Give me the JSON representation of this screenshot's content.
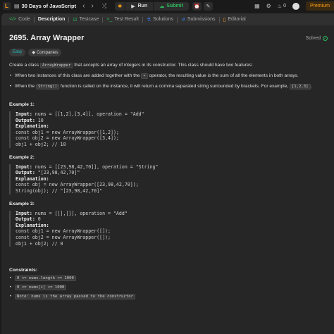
{
  "topbar": {
    "list_title": "30 Days of JavaScript",
    "run_label": "Run",
    "submit_label": "Submit",
    "streak_count": "0",
    "premium_label": "Premium"
  },
  "tabs": [
    {
      "label": "Code"
    },
    {
      "label": "Description"
    },
    {
      "label": "Testcase"
    },
    {
      "label": "Test Result"
    },
    {
      "label": "Solutions"
    },
    {
      "label": "Submissions"
    },
    {
      "label": "Editorial"
    }
  ],
  "problem": {
    "title": "2695. Array Wrapper",
    "status": "Solved",
    "difficulty": "Easy",
    "companies_label": "Companies",
    "intro_a": "Create a class ",
    "intro_code": "ArrayWrapper",
    "intro_b": " that accepts an array of integers in its constructor. This class should have two features:",
    "bullet1_a": "When two instances of this class are added together with the ",
    "bullet1_code": "+",
    "bullet1_b": " operator, the resulting value is the sum of all the elements in both arrays.",
    "bullet2_a": "When the ",
    "bullet2_code": "String()",
    "bullet2_b": " function is called on the instance, it will return a comma separated string surrounded by brackets. For example, ",
    "bullet2_code2": "[1,2,3]",
    "bullet2_c": "."
  },
  "examples": [
    {
      "title": "Example 1:",
      "input_label": "Input:",
      "input": " nums = [[1,2],[3,4]], operation = \"Add\"",
      "output_label": "Output:",
      "output": " 10",
      "explanation_label": "Explanation:",
      "lines": "const obj1 = new ArrayWrapper([1,2]);\nconst obj2 = new ArrayWrapper([3,4]);\nobj1 + obj2; // 10"
    },
    {
      "title": "Example 2:",
      "input_label": "Input:",
      "input": " nums = [[23,98,42,70]], operation = \"String\"",
      "output_label": "Output:",
      "output": " \"[23,98,42,70]\"",
      "explanation_label": "Explanation:",
      "lines": "const obj = new ArrayWrapper([23,98,42,70]);\nString(obj); // \"[23,98,42,70]\""
    },
    {
      "title": "Example 3:",
      "input_label": "Input:",
      "input": " nums = [[],[]], operation = \"Add\"",
      "output_label": "Output:",
      "output": " 0",
      "explanation_label": "Explanation:",
      "lines": "const obj1 = new ArrayWrapper([]);\nconst obj2 = new ArrayWrapper([]);\nobj1 + obj2; // 0"
    }
  ],
  "constraints": {
    "title": "Constraints:",
    "items": [
      "0 <= nums.length <= 1000",
      "0 <= nums[i] <= 1000",
      "Note: nums is the array passed to the constructor"
    ]
  }
}
